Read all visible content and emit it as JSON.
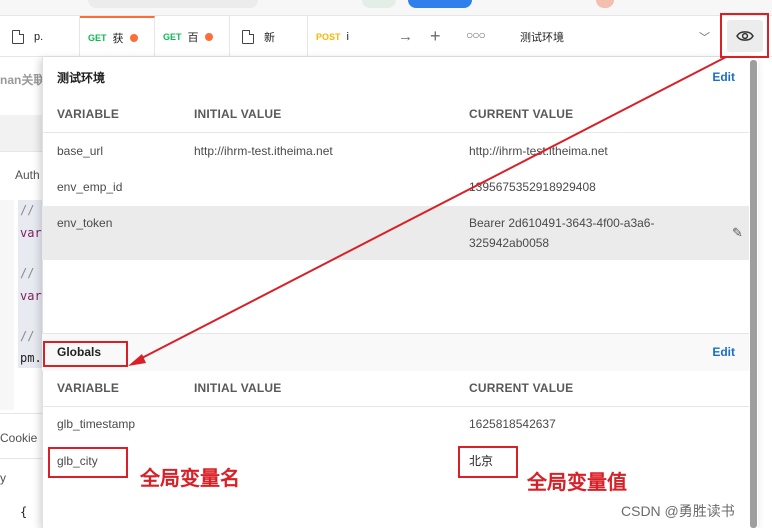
{
  "tabs": [
    {
      "method": "",
      "label": "p."
    },
    {
      "method": "GET",
      "label": "获",
      "unsaved": true
    },
    {
      "method": "GET",
      "label": "百",
      "unsaved": true
    },
    {
      "method": "",
      "label": "新"
    },
    {
      "method": "POST",
      "label": "i"
    }
  ],
  "environment": {
    "selected": "测试环境"
  },
  "background": {
    "collection_fragment": "nan关联",
    "auth_fragment": "Auth",
    "code_lines": [
      "//",
      "var",
      "//",
      "var",
      "//",
      "pm."
    ],
    "cookies_fragment": "Cookie",
    "body_fragment": "y",
    "brace_fragment": "{"
  },
  "env_panel": {
    "title": "测试环境",
    "edit": "Edit",
    "headers": [
      "VARIABLE",
      "INITIAL VALUE",
      "CURRENT VALUE"
    ],
    "rows": [
      {
        "variable": "base_url",
        "initial": "http://ihrm-test.itheima.net",
        "current": "http://ihrm-test.itheima.net"
      },
      {
        "variable": "env_emp_id",
        "initial": "",
        "current": "1395675352918929408"
      },
      {
        "variable": "env_token",
        "initial": "",
        "current_line1": "Bearer 2d610491-3643-4f00-a3a6-",
        "current_line2": "325942ab0058"
      }
    ]
  },
  "globals_panel": {
    "title": "Globals",
    "edit": "Edit",
    "headers": [
      "VARIABLE",
      "INITIAL VALUE",
      "CURRENT VALUE"
    ],
    "rows": [
      {
        "variable": "glb_timestamp",
        "initial": "",
        "current": "1625818542637"
      },
      {
        "variable": "glb_city",
        "initial": "",
        "current": "北京"
      }
    ]
  },
  "annotations": {
    "var_name": "全局变量名",
    "var_value": "全局变量值"
  },
  "watermark": "CSDN @勇胜读书",
  "colors": {
    "accent": "#ff6c37",
    "annotation_red": "#d92027",
    "link_blue": "#1a6fc4",
    "get_green": "#0cbb52",
    "post_orange": "#ffb400"
  }
}
